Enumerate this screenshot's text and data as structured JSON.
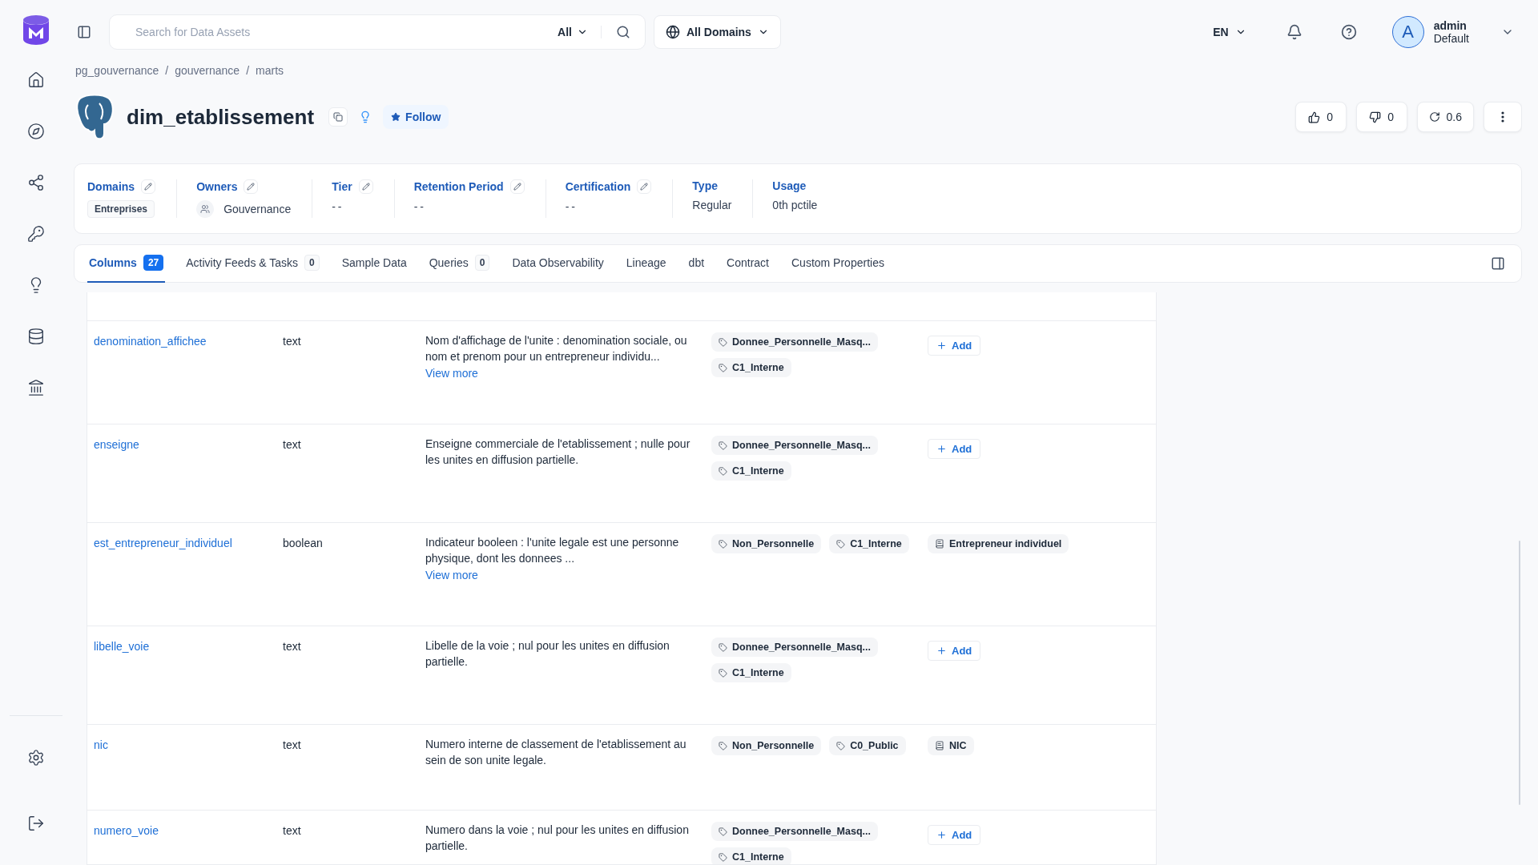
{
  "search": {
    "placeholder": "Search for Data Assets",
    "filter": "All"
  },
  "domain_selector": "All Domains",
  "language": "EN",
  "user": {
    "initial": "A",
    "name": "admin",
    "role": "Default"
  },
  "breadcrumb": {
    "items": [
      "pg_gouvernance",
      "gouvernance",
      "marts"
    ],
    "separator": "/"
  },
  "asset": {
    "name": "dim_etablissement",
    "follow": "Follow",
    "votes_up": "0",
    "votes_down": "0",
    "version": "0.6"
  },
  "properties": [
    {
      "label": "Domains",
      "editable": true,
      "kind": "chip",
      "value": "Entreprises"
    },
    {
      "label": "Owners",
      "editable": true,
      "kind": "owner",
      "value": "Gouvernance"
    },
    {
      "label": "Tier",
      "editable": true,
      "kind": "empty",
      "value": "--"
    },
    {
      "label": "Retention Period",
      "editable": true,
      "kind": "empty",
      "value": "--"
    },
    {
      "label": "Certification",
      "editable": true,
      "kind": "empty",
      "value": "--"
    },
    {
      "label": "Type",
      "editable": false,
      "kind": "plain",
      "value": "Regular"
    },
    {
      "label": "Usage",
      "editable": false,
      "kind": "plain",
      "value": "0th pctile"
    }
  ],
  "tabs": [
    {
      "label": "Columns",
      "count": "27",
      "selected": true
    },
    {
      "label": "Activity Feeds & Tasks",
      "count": "0",
      "selected": false
    },
    {
      "label": "Sample Data",
      "selected": false
    },
    {
      "label": "Queries",
      "count": "0",
      "selected": false
    },
    {
      "label": "Data Observability",
      "selected": false
    },
    {
      "label": "Lineage",
      "selected": false
    },
    {
      "label": "dbt",
      "selected": false
    },
    {
      "label": "Contract",
      "selected": false
    },
    {
      "label": "Custom Properties",
      "selected": false
    }
  ],
  "table": {
    "rows": [
      {
        "name": "denomination_affichee",
        "type": "text",
        "description": "Nom d'affichage de l'unite : denomination sociale, ou nom et prenom pour un entrepreneur individu...",
        "view_more": "View more",
        "tags": [
          "Donnee_Personnelle_Masq...",
          "C1_Interne"
        ],
        "add": "Add"
      },
      {
        "name": "enseigne",
        "type": "text",
        "description": "Enseigne commerciale de l'etablissement ; nulle pour les unites en diffusion partielle.",
        "tags": [
          "Donnee_Personnelle_Masq...",
          "C1_Interne"
        ],
        "add": "Add"
      },
      {
        "name": "est_entrepreneur_individuel",
        "type": "boolean",
        "description": "Indicateur booleen : l'unite legale est une personne physique, dont les donnees ...",
        "view_more": "View more",
        "tags": [
          "Non_Personnelle",
          "C1_Interne"
        ],
        "glossary": [
          "Entrepreneur individuel"
        ]
      },
      {
        "name": "libelle_voie",
        "type": "text",
        "description": "Libelle de la voie ; nul pour les unites en diffusion partielle.",
        "tags": [
          "Donnee_Personnelle_Masq...",
          "C1_Interne"
        ],
        "add": "Add"
      },
      {
        "name": "nic",
        "type": "text",
        "description": "Numero interne de classement de l'etablissement au sein de son unite legale.",
        "tags": [
          "Non_Personnelle",
          "C0_Public"
        ],
        "glossary": [
          "NIC"
        ]
      },
      {
        "name": "numero_voie",
        "type": "text",
        "description": "Numero dans la voie ; nul pour les unites en diffusion partielle.",
        "tags": [
          "Donnee_Personnelle_Masq...",
          "C1_Interne"
        ],
        "add": "Add"
      }
    ]
  }
}
